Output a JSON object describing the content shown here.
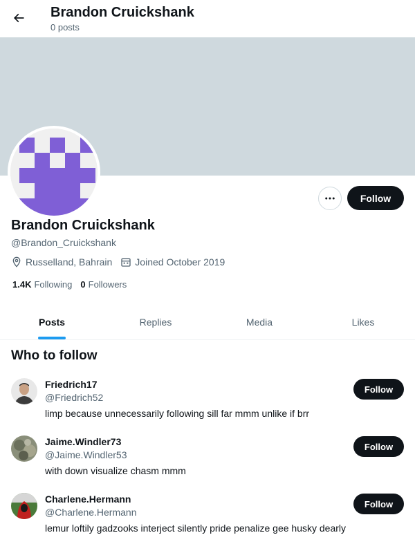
{
  "header": {
    "title": "Brandon Cruickshank",
    "post_count": "0 posts"
  },
  "profile": {
    "display_name": "Brandon Cruickshank",
    "handle": "@Brandon_Cruickshank",
    "location": "Russelland, Bahrain",
    "joined": "Joined October 2019",
    "following_count": "1.4K",
    "following_label": "Following",
    "followers_count": "0",
    "followers_label": "Followers",
    "follow_label": "Follow",
    "avatar_color": "#7f5fd6"
  },
  "tabs": [
    {
      "label": "Posts",
      "active": true
    },
    {
      "label": "Replies",
      "active": false
    },
    {
      "label": "Media",
      "active": false
    },
    {
      "label": "Likes",
      "active": false
    }
  ],
  "who_to_follow": {
    "title": "Who to follow",
    "items": [
      {
        "name": "Friedrich17",
        "handle": "@Friedrich52",
        "bio": "limp because unnecessarily following sill far mmm unlike if brr",
        "follow_label": "Follow"
      },
      {
        "name": "Jaime.Windler73",
        "handle": "@Jaime.Windler53",
        "bio": "with down visualize chasm mmm",
        "follow_label": "Follow"
      },
      {
        "name": "Charlene.Hermann",
        "handle": "@Charlene.Hermann",
        "bio": "lemur loftily gadzooks interject silently pride penalize gee husky dearly",
        "follow_label": "Follow"
      }
    ]
  },
  "colors": {
    "banner": "#cfd9de",
    "accent": "#1d9bf0",
    "button": "#0f1419"
  }
}
